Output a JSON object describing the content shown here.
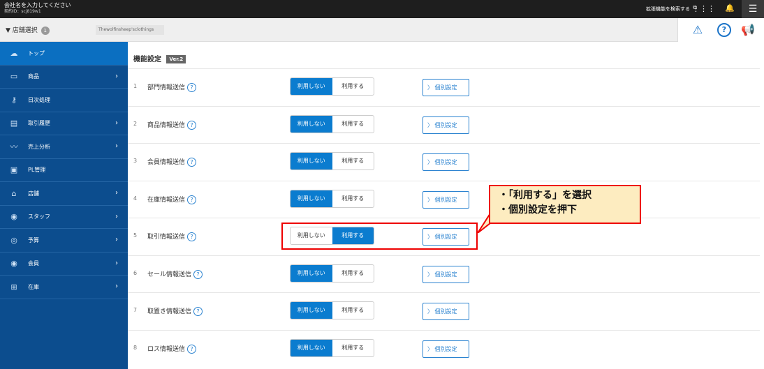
{
  "topbar": {
    "company_name": "会社名を入力してください",
    "contract_id": "契約ID：scj819w1",
    "extension_search": "拡張機能を検索する"
  },
  "subbar": {
    "store_select_label": "店舗選択",
    "store_count": "1",
    "store_name": "Thewolfinsheep'sclothings"
  },
  "sidebar": {
    "items": [
      {
        "label": "トップ",
        "icon": "cloud-icon",
        "has_arrow": false
      },
      {
        "label": "商品",
        "icon": "product-icon",
        "has_arrow": true
      },
      {
        "label": "日次処理",
        "icon": "key-icon",
        "has_arrow": false
      },
      {
        "label": "取引履歴",
        "icon": "history-icon",
        "has_arrow": true
      },
      {
        "label": "売上分析",
        "icon": "chart-icon",
        "has_arrow": true
      },
      {
        "label": "PL管理",
        "icon": "pl-icon",
        "has_arrow": false
      },
      {
        "label": "店舗",
        "icon": "store-icon",
        "has_arrow": true
      },
      {
        "label": "スタッフ",
        "icon": "staff-icon",
        "has_arrow": true
      },
      {
        "label": "予算",
        "icon": "budget-icon",
        "has_arrow": true
      },
      {
        "label": "会員",
        "icon": "member-icon",
        "has_arrow": true
      },
      {
        "label": "在庫",
        "icon": "inventory-icon",
        "has_arrow": true
      }
    ]
  },
  "main": {
    "title": "機能設定",
    "version": "Ver.2",
    "toggle_off_label": "利用しない",
    "toggle_on_label": "利用する",
    "individual_label": "個別設定",
    "rows": [
      {
        "num": "1",
        "label": "部門情報送信",
        "selected": "off"
      },
      {
        "num": "2",
        "label": "商品情報送信",
        "selected": "off"
      },
      {
        "num": "3",
        "label": "会員情報送信",
        "selected": "off"
      },
      {
        "num": "4",
        "label": "在庫情報送信",
        "selected": "off"
      },
      {
        "num": "5",
        "label": "取引情報送信",
        "selected": "on"
      },
      {
        "num": "6",
        "label": "セール情報送信",
        "selected": "off"
      },
      {
        "num": "7",
        "label": "取置き情報送信",
        "selected": "off"
      },
      {
        "num": "8",
        "label": "ロス情報送信",
        "selected": "off"
      }
    ]
  },
  "callout": {
    "line1": "・「利用する」を選択",
    "line2": "・個別設定を押下"
  },
  "colors": {
    "sidebar_bg": "#0c4d8e",
    "accent": "#0b7ccf",
    "highlight": "#e00000",
    "callout_bg": "#fdecc0"
  }
}
